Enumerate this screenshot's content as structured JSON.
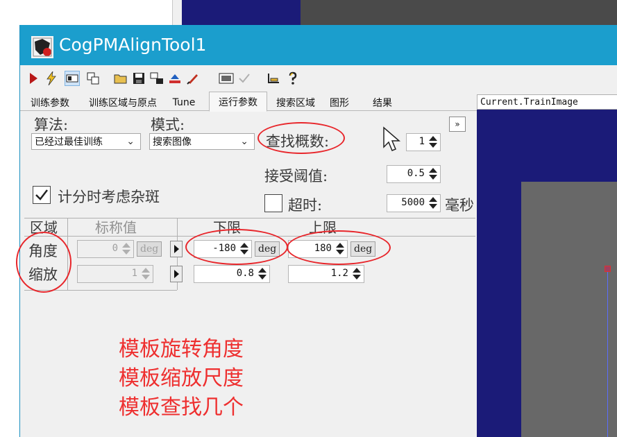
{
  "window": {
    "title": "CogPMAlignTool1"
  },
  "tabs": [
    {
      "label": "训练参数"
    },
    {
      "label": "训练区域与原点"
    },
    {
      "label": "Tune"
    },
    {
      "label": "运行参数"
    },
    {
      "label": "搜索区域"
    },
    {
      "label": "图形"
    },
    {
      "label": "结果"
    }
  ],
  "run_params": {
    "algorithm": {
      "label": "算法:",
      "value": "已经过最佳训练"
    },
    "mode": {
      "label": "模式:",
      "value": "搜索图像"
    },
    "find_count": {
      "label": "查找概数:",
      "value": "1"
    },
    "accept_threshold": {
      "label": "接受阈值:",
      "value": "0.5"
    },
    "consider_clutter": {
      "label": "计分时考虑杂斑",
      "checked": true
    },
    "timeout": {
      "label": "超时:",
      "value": "5000",
      "unit": "毫秒",
      "checked": false
    }
  },
  "dof_table": {
    "headers": {
      "area": "区域",
      "nominal": "标称值",
      "low": "下限",
      "high": "上限"
    },
    "rows": [
      {
        "name": "角度",
        "nominal": "0",
        "nominal_unit": "deg",
        "low": "-180",
        "low_unit": "deg",
        "high": "180",
        "high_unit": "deg"
      },
      {
        "name": "缩放",
        "nominal": "1",
        "low": "0.8",
        "high": "1.2"
      }
    ]
  },
  "image_panel": {
    "header": "Current.TrainImage"
  },
  "annotations": {
    "line1": "模板旋转角度",
    "line2": "模板缩放尺度",
    "line3": "模板查找几个"
  },
  "colors": {
    "titlebar": "#1b9ecd",
    "annotation_red": "#ee2f2f",
    "image_bg": "#1b1b78"
  }
}
